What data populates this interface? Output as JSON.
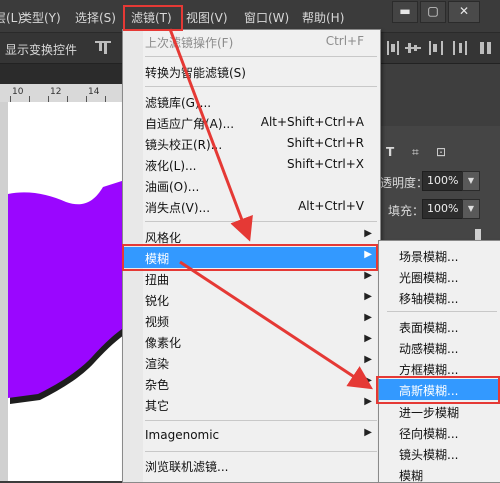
{
  "menubar": {
    "items": [
      "图层(L)",
      "类型(Y)",
      "选择(S)",
      "滤镜(T)",
      "视图(V)",
      "窗口(W)",
      "帮助(H)"
    ],
    "window_buttons": [
      "minimize",
      "restore",
      "close"
    ]
  },
  "options_bar": {
    "show_transform_label": "显示变换控件"
  },
  "ruler": {
    "ticks": [
      "10",
      "12",
      "14"
    ]
  },
  "right_panel": {
    "type_icons": [
      "T",
      "T",
      "⌗",
      "⌗",
      "⊡"
    ],
    "opacity_label": "透明度：",
    "opacity_value": "100%",
    "fill_label": "填充：",
    "fill_value": "100%"
  },
  "filter_menu": {
    "items": [
      {
        "label": "上次滤镜操作(F)",
        "shortcut": "Ctrl+F",
        "disabled": true
      },
      {
        "label": "转换为智能滤镜(S)"
      },
      {
        "label": "滤镜库(G)..."
      },
      {
        "label": "自适应广角(A)...",
        "shortcut": "Alt+Shift+Ctrl+A"
      },
      {
        "label": "镜头校正(R)...",
        "shortcut": "Shift+Ctrl+R"
      },
      {
        "label": "液化(L)...",
        "shortcut": "Shift+Ctrl+X"
      },
      {
        "label": "油画(O)..."
      },
      {
        "label": "消失点(V)...",
        "shortcut": "Alt+Ctrl+V"
      },
      {
        "label": "风格化"
      },
      {
        "label": "模糊",
        "highlighted": true
      },
      {
        "label": "扭曲"
      },
      {
        "label": "锐化"
      },
      {
        "label": "视频"
      },
      {
        "label": "像素化"
      },
      {
        "label": "渲染"
      },
      {
        "label": "杂色"
      },
      {
        "label": "其它"
      },
      {
        "label": "Imagenomic"
      },
      {
        "label": "浏览联机滤镜..."
      }
    ]
  },
  "blur_submenu": {
    "items": [
      {
        "label": "场景模糊..."
      },
      {
        "label": "光圈模糊..."
      },
      {
        "label": "移轴模糊..."
      },
      {
        "label": "表面模糊..."
      },
      {
        "label": "动感模糊..."
      },
      {
        "label": "方框模糊..."
      },
      {
        "label": "高斯模糊...",
        "highlighted": true
      },
      {
        "label": "进一步模糊"
      },
      {
        "label": "径向模糊..."
      },
      {
        "label": "镜头模糊..."
      },
      {
        "label": "模糊"
      }
    ]
  },
  "colors": {
    "highlight": "#3399ff",
    "annotation_red": "#e53935",
    "shape_purple": "#9a06ff"
  }
}
